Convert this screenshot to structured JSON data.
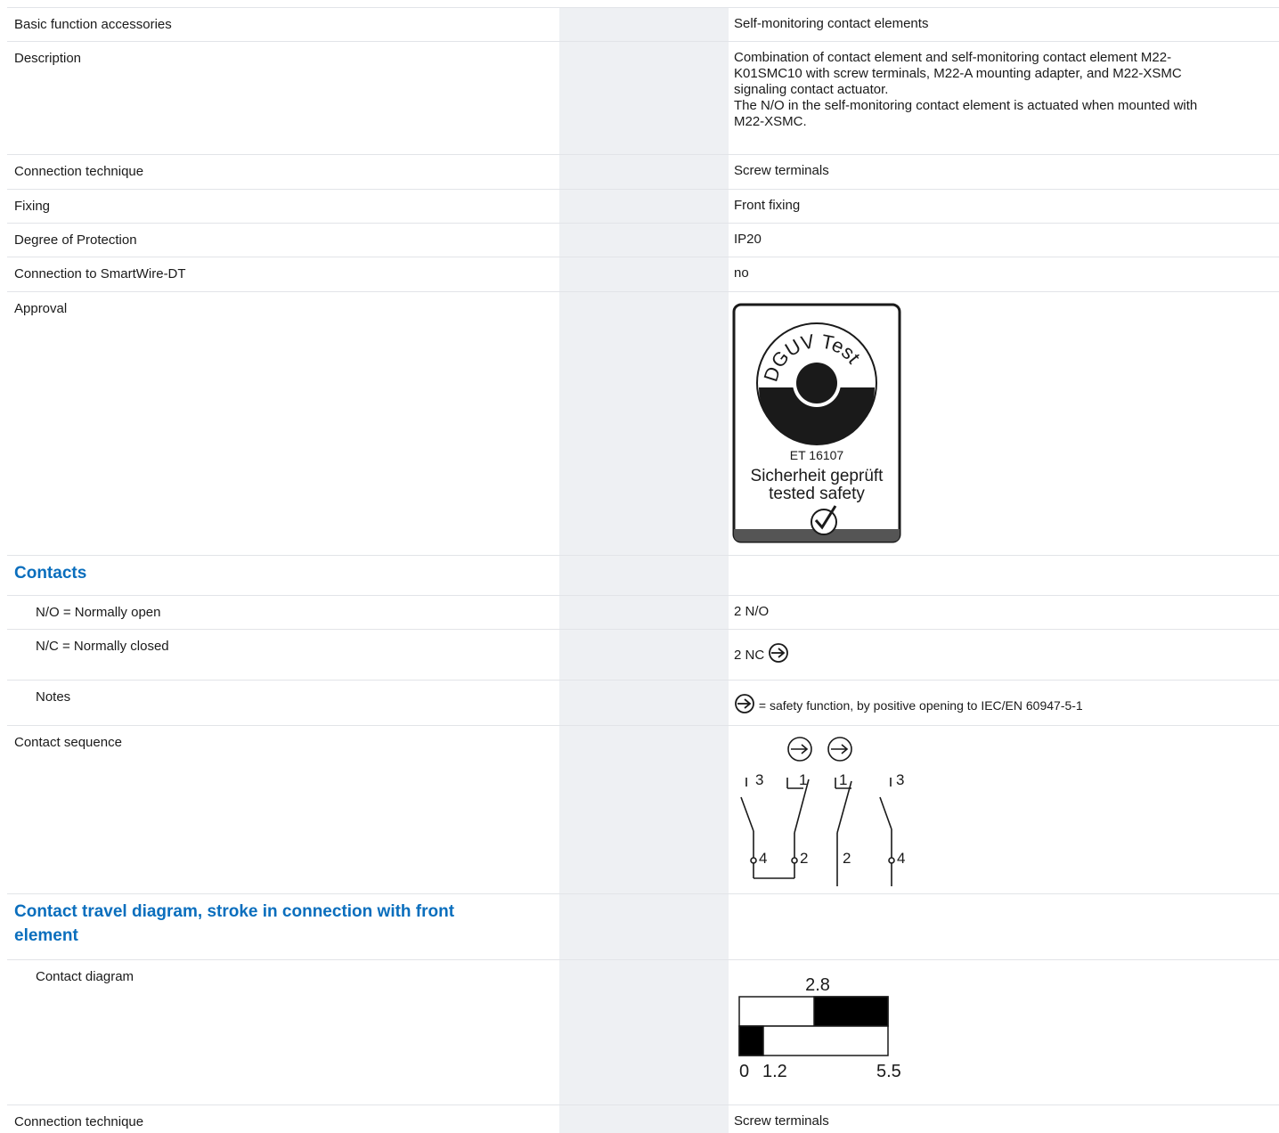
{
  "header": {
    "partial_title": ""
  },
  "rows": {
    "basic": {
      "label": "Basic function accessories",
      "value": "Self-monitoring contact elements"
    },
    "description": {
      "label": "Description",
      "value_line1": "Combination of contact element and self-monitoring contact element M22-",
      "value_line2": "K01SMC10 with screw terminals, M22-A mounting adapter, and M22-XSMC",
      "value_line3": "signaling contact actuator.",
      "value_line4": "The N/O in the self-monitoring contact element is actuated when mounted with",
      "value_line5": "M22-XSMC."
    },
    "connection1": {
      "label": "Connection technique",
      "value": "Screw terminals"
    },
    "fixing": {
      "label": "Fixing",
      "value": "Front fixing"
    },
    "protection": {
      "label": "Degree of Protection",
      "value": "IP20"
    },
    "smartwire": {
      "label": "Connection to SmartWire-DT",
      "value": "no"
    },
    "approval": {
      "label": "Approval",
      "badge": {
        "arc_text": "DGUV Test",
        "number": "ET 16107",
        "line1": "Sicherheit geprüft",
        "line2": "tested safety"
      }
    },
    "contacts_section": {
      "label": "Contacts"
    },
    "no": {
      "label": "N/O = Normally open",
      "value": "2 N/O"
    },
    "nc": {
      "label": "N/C = Normally closed",
      "value": "2 NC",
      "icon": "positive-opening-icon"
    },
    "notes": {
      "label": "Notes",
      "value": " = safety function, by positive opening to IEC/EN 60947-5-1",
      "icon": "positive-opening-icon"
    },
    "sequence": {
      "label": "Contact sequence",
      "terminals": [
        "3",
        "4",
        "1",
        "2",
        "1",
        "2",
        "3",
        "4"
      ]
    },
    "travel_section": {
      "label": "Contact travel diagram, stroke in connection with front element"
    },
    "contact_diagram": {
      "label": "Contact diagram",
      "top_mark": "2.8",
      "bottom_marks": [
        "0",
        "1.2",
        "5.5"
      ]
    },
    "connection2": {
      "label": "Connection technique",
      "value": "Screw terminals"
    }
  }
}
